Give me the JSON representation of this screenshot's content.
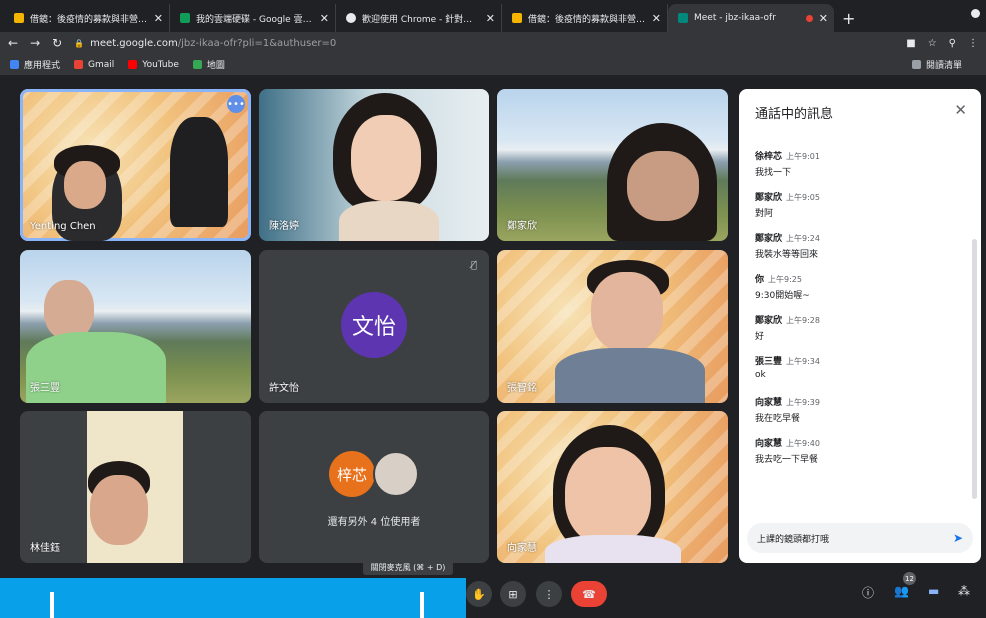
{
  "browser": {
    "tabs": [
      {
        "title": "借鏡：後疫情的募款與非營利組織",
        "fav": "#f4b400",
        "fav_icon": "bookmark-icon"
      },
      {
        "title": "我的雲端硬碟 - Google 雲端硬碟",
        "fav": "#0f9d58",
        "fav_icon": "drive-icon"
      },
      {
        "title": "歡迎使用 Chrome - 針對你喜愛的",
        "fav": "#e8eaed",
        "fav_icon": "chrome-icon"
      },
      {
        "title": "借鏡：後疫情的募款與非營利組織",
        "fav": "#f4b400",
        "fav_icon": "bookmark-icon"
      },
      {
        "title": "Meet - jbz-ikaa-ofr",
        "fav": "#00897b",
        "fav_icon": "meet-icon",
        "active": true
      }
    ],
    "new_tab": "+",
    "url_host": "meet.google.com",
    "url_path": "/jbz-ikaa-ofr?pli=1&authuser=0",
    "bookmarks": [
      {
        "label": "應用程式",
        "color": "#4285f4",
        "icon": "apps-grid-icon"
      },
      {
        "label": "Gmail",
        "color": "#ea4335",
        "icon": "gmail-icon"
      },
      {
        "label": "YouTube",
        "color": "#ff0000",
        "icon": "youtube-icon"
      },
      {
        "label": "地圖",
        "color": "#34a853",
        "icon": "maps-icon"
      }
    ],
    "reading_list": "閱讀清單"
  },
  "participants": [
    {
      "name": "Yenting Chen"
    },
    {
      "name": "陳洛婷"
    },
    {
      "name": "鄭家欣"
    },
    {
      "name": "張三豐"
    },
    {
      "name": "許文怡",
      "avatar": "文怡",
      "avatar_color": "#5e35b1"
    },
    {
      "name": "張智銘"
    },
    {
      "name": "林佳鈺"
    },
    {
      "group_avatar": "梓芯",
      "group_color": "#e8711c",
      "others": "還有另外 4 位使用者"
    },
    {
      "name": "向家慧"
    }
  ],
  "chat": {
    "title": "通話中的訊息",
    "messages": [
      {
        "sender": "徐梓芯",
        "time": "上午9:01",
        "text": "我找一下"
      },
      {
        "sender": "鄭家欣",
        "time": "上午9:05",
        "text": "對阿"
      },
      {
        "sender": "鄭家欣",
        "time": "上午9:24",
        "text": "我裝水等等回來"
      },
      {
        "sender": "你",
        "time": "上午9:25",
        "text": "9:30開始喔~"
      },
      {
        "sender": "鄭家欣",
        "time": "上午9:28",
        "text": "好"
      },
      {
        "sender": "張三豐",
        "time": "上午9:34",
        "text": "ok"
      },
      {
        "sender": "向家慧",
        "time": "上午9:39",
        "text": "我在吃早餐"
      },
      {
        "sender": "向家慧",
        "time": "上午9:40",
        "text": "我去吃一下早餐"
      }
    ],
    "input_value": "上課的鏡頭都打哦"
  },
  "controls": {
    "mic_tooltip": "關閉麥克風 (⌘ + D)",
    "participants_count": "12"
  },
  "colors": {
    "accent": "#1a73e8",
    "hangup": "#ea4335",
    "overlay": "#08a0e8"
  }
}
